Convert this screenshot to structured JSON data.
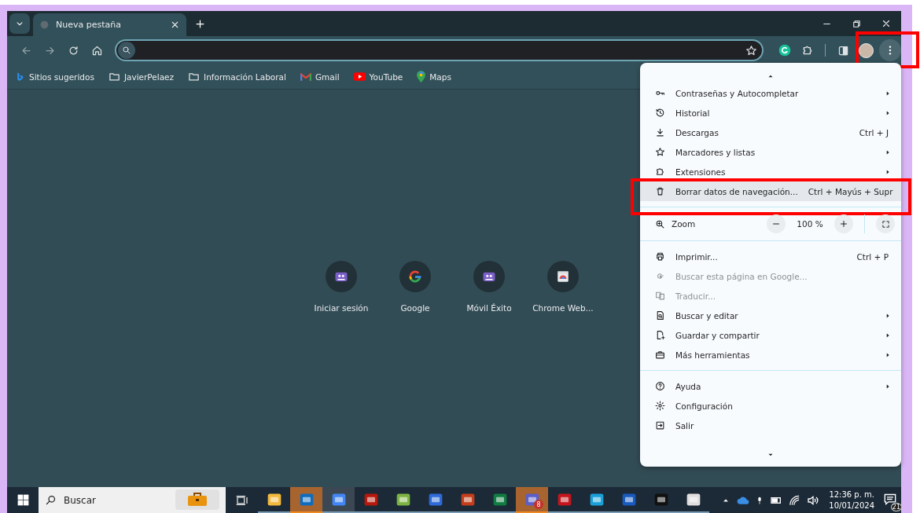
{
  "tabs": [
    {
      "title": "Nueva pestaña",
      "selected": true
    }
  ],
  "bookmarks": [
    {
      "label": "Sitios sugeridos"
    },
    {
      "label": "JavierPelaez"
    },
    {
      "label": "Información Laboral"
    },
    {
      "label": "Gmail"
    },
    {
      "label": "YouTube"
    },
    {
      "label": "Maps"
    }
  ],
  "toolbar": {
    "menu_button_annotated": true
  },
  "shortcuts": [
    {
      "label": "Iniciar sesión"
    },
    {
      "label": "Google"
    },
    {
      "label": "Móvil Éxito"
    },
    {
      "label": "Chrome Web..."
    }
  ],
  "menu": {
    "items": [
      {
        "kind": "item",
        "label": "Contraseñas y Autocompletar",
        "submenu": true,
        "disabled": false,
        "highlighted": false,
        "annotated": false
      },
      {
        "kind": "item",
        "label": "Historial",
        "submenu": true,
        "disabled": false,
        "highlighted": false,
        "annotated": false
      },
      {
        "kind": "item",
        "label": "Descargas",
        "shortcut": "Ctrl + J",
        "submenu": false,
        "disabled": false,
        "highlighted": false,
        "annotated": false
      },
      {
        "kind": "item",
        "label": "Marcadores y listas",
        "submenu": true,
        "disabled": false,
        "highlighted": false,
        "annotated": false
      },
      {
        "kind": "item",
        "label": "Extensiones",
        "submenu": true,
        "disabled": false,
        "highlighted": false,
        "annotated": false
      },
      {
        "kind": "item",
        "label": "Borrar datos de navegación...",
        "shortcut": "Ctrl + Mayús + Supr",
        "submenu": false,
        "disabled": false,
        "highlighted": true,
        "annotated": true
      },
      {
        "kind": "divider"
      },
      {
        "kind": "zoom",
        "label": "Zoom",
        "value": "100 %"
      },
      {
        "kind": "divider"
      },
      {
        "kind": "item",
        "label": "Imprimir...",
        "shortcut": "Ctrl + P",
        "submenu": false,
        "disabled": false,
        "highlighted": false,
        "annotated": false
      },
      {
        "kind": "item",
        "label": "Buscar esta página en Google...",
        "submenu": false,
        "disabled": true,
        "highlighted": false,
        "annotated": false
      },
      {
        "kind": "item",
        "label": "Traducir...",
        "submenu": false,
        "disabled": true,
        "highlighted": false,
        "annotated": false
      },
      {
        "kind": "item",
        "label": "Buscar y editar",
        "submenu": true,
        "disabled": false,
        "highlighted": false,
        "annotated": false
      },
      {
        "kind": "item",
        "label": "Guardar y compartir",
        "submenu": true,
        "disabled": false,
        "highlighted": false,
        "annotated": false
      },
      {
        "kind": "item",
        "label": "Más herramientas",
        "submenu": true,
        "disabled": false,
        "highlighted": false,
        "annotated": false
      },
      {
        "kind": "divider"
      },
      {
        "kind": "item",
        "label": "Ayuda",
        "submenu": true,
        "disabled": false,
        "highlighted": false,
        "annotated": false
      },
      {
        "kind": "item",
        "label": "Configuración",
        "submenu": false,
        "disabled": false,
        "highlighted": false,
        "annotated": false
      },
      {
        "kind": "item",
        "label": "Salir",
        "submenu": false,
        "disabled": false,
        "highlighted": false,
        "annotated": false
      }
    ]
  },
  "taskbar": {
    "search_placeholder": "Buscar",
    "apps": [
      {
        "attention": false,
        "active": false
      },
      {
        "attention": true,
        "active": false
      },
      {
        "attention": false,
        "active": true
      },
      {
        "attention": false,
        "active": false
      },
      {
        "attention": false,
        "active": false
      },
      {
        "attention": false,
        "active": false
      },
      {
        "attention": false,
        "active": false
      },
      {
        "attention": false,
        "active": false
      },
      {
        "attention": true,
        "active": false,
        "badge": "8"
      },
      {
        "attention": false,
        "active": false
      },
      {
        "attention": false,
        "active": false
      },
      {
        "attention": false,
        "active": false
      },
      {
        "attention": false,
        "active": false
      },
      {
        "attention": false,
        "active": false
      }
    ],
    "time": "12:36 p. m.",
    "date": "10/01/2024",
    "notifications": "21"
  }
}
